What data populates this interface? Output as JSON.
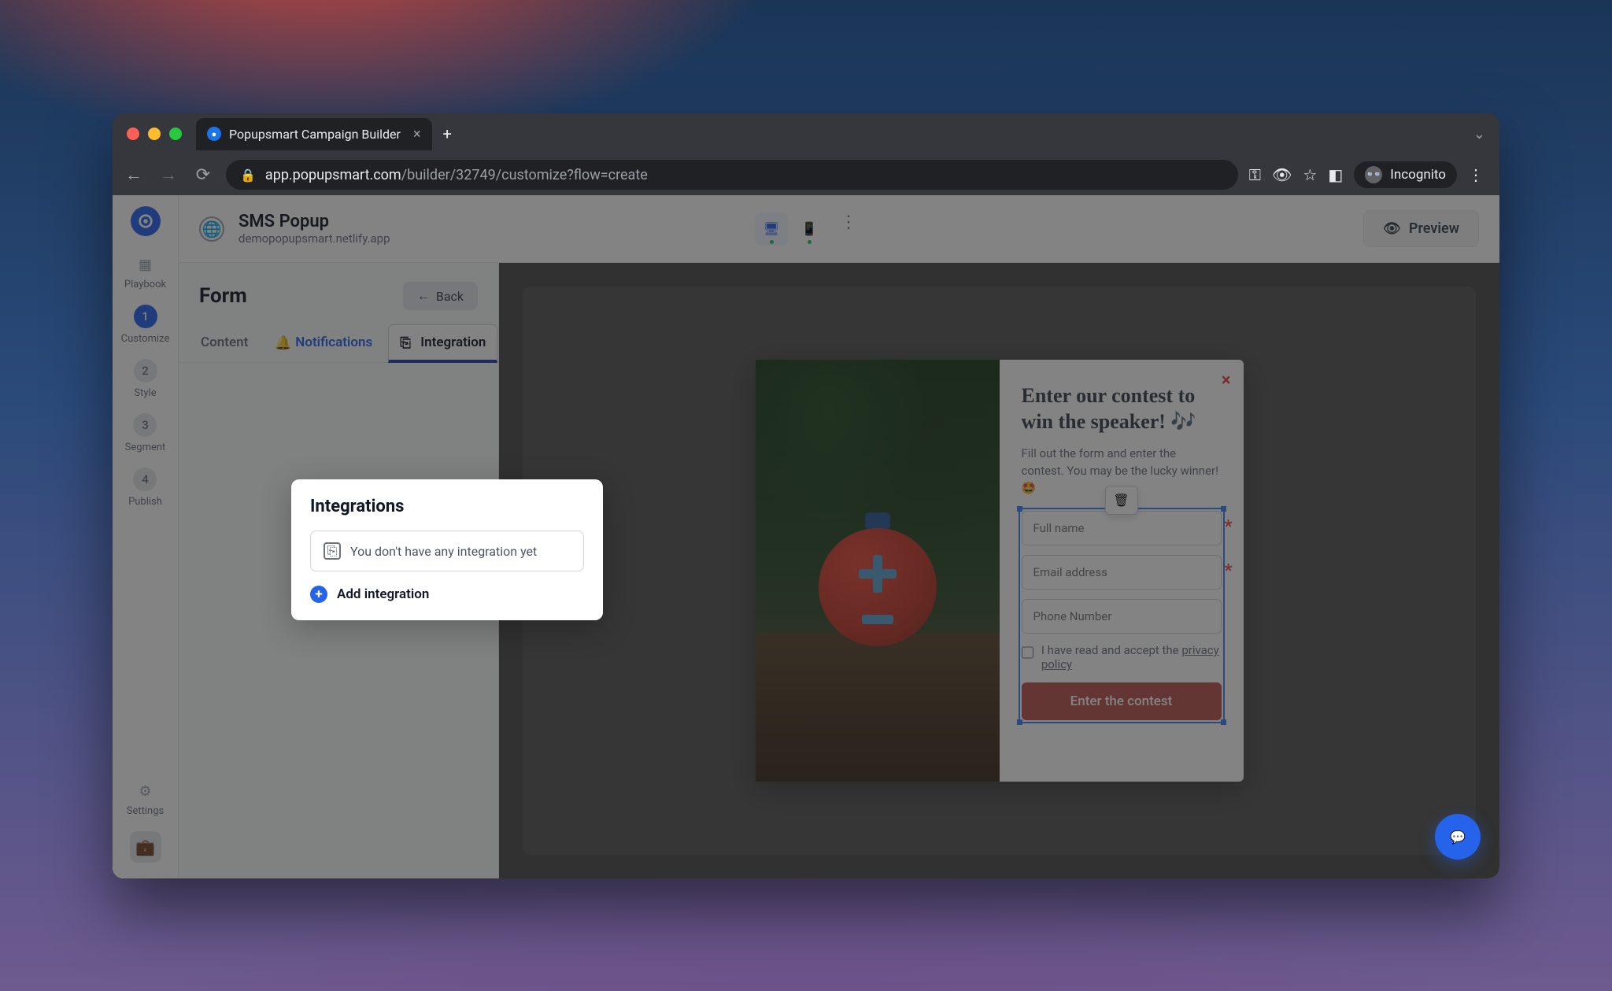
{
  "browser": {
    "tab_title": "Popupsmart Campaign Builder",
    "url_domain": "app.popupsmart.com",
    "url_path": "/builder/32749/customize?flow=create",
    "incognito_label": "Incognito"
  },
  "header": {
    "campaign_title": "SMS Popup",
    "campaign_url": "demopopupsmart.netlify.app",
    "preview_label": "Preview"
  },
  "rail": {
    "playbook": "Playbook",
    "steps": [
      {
        "num": "1",
        "label": "Customize",
        "active": true
      },
      {
        "num": "2",
        "label": "Style",
        "active": false
      },
      {
        "num": "3",
        "label": "Segment",
        "active": false
      },
      {
        "num": "4",
        "label": "Publish",
        "active": false
      }
    ],
    "settings": "Settings"
  },
  "sidebar": {
    "title": "Form",
    "back": "Back",
    "tabs": {
      "content": "Content",
      "notifications": "Notifications",
      "integration": "Integration"
    }
  },
  "popover": {
    "title": "Integrations",
    "empty_message": "You don't have any integration yet",
    "add_label": "Add integration"
  },
  "popup": {
    "title": "Enter our contest to win the speaker! 🎶",
    "subtitle_1": "Fill out the form and enter the contest. You may be the lucky winner! 🤩",
    "fullname_placeholder": "Full name",
    "email_placeholder": "Email address",
    "phone_placeholder": "Phone Number",
    "consent_text": "I have read and accept the ",
    "privacy_link": "privacy policy",
    "submit_label": "Enter the contest"
  }
}
